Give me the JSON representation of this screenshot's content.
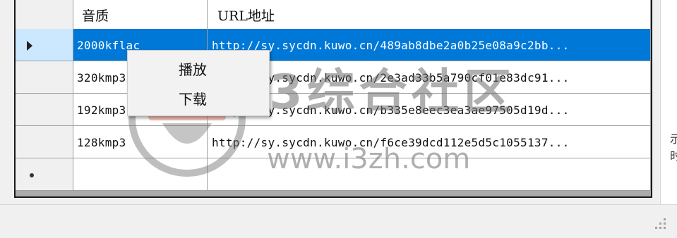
{
  "grid": {
    "columns": [
      "",
      "音质",
      "URL地址"
    ],
    "rows": [
      {
        "quality": "2000kflac",
        "url": "http://sy.sycdn.kuwo.cn/489ab8dbe2a0b25e08a9c2bb...",
        "selected": true
      },
      {
        "quality": "320kmp3",
        "url": "http://sy.sycdn.kuwo.cn/2e3ad33b5a790cf01e83dc91...",
        "selected": false
      },
      {
        "quality": "192kmp3",
        "url": "http://sy.sycdn.kuwo.cn/b335e8eec3ea3ae97505d19d...",
        "selected": false
      },
      {
        "quality": "128kmp3",
        "url": "http://sy.sycdn.kuwo.cn/f6ce39dcd112e5d5c1055137...",
        "selected": false
      }
    ]
  },
  "context_menu": {
    "items": [
      "播放",
      "下载"
    ]
  },
  "watermark": {
    "title": "i3综合社区",
    "url": "www.i3zh.com"
  },
  "colors": {
    "selection": "#0078d7",
    "row_header_selected": "#cce8ff"
  },
  "icons": {
    "current_row": "triangle-right",
    "new_row": "asterisk-dot",
    "resize_grip": "dots-grip"
  }
}
